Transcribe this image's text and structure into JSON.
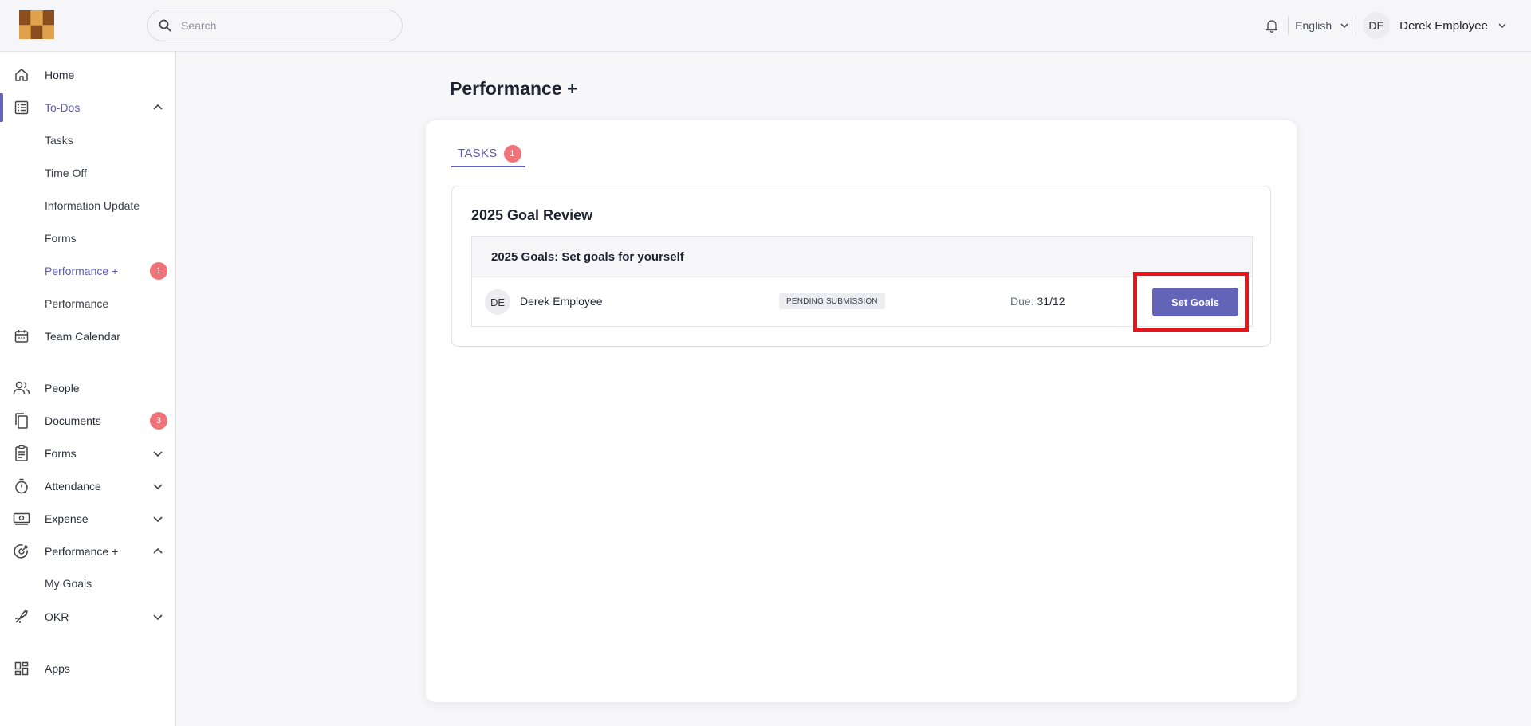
{
  "header": {
    "search_placeholder": "Search",
    "language": "English",
    "user_initials": "DE",
    "user_name": "Derek Employee"
  },
  "sidebar": {
    "items": [
      {
        "label": "Home",
        "icon": "home-icon"
      },
      {
        "label": "To-Dos",
        "icon": "checklist-icon",
        "expanded": true,
        "active": true,
        "children": [
          {
            "label": "Tasks"
          },
          {
            "label": "Time Off"
          },
          {
            "label": "Information Update"
          },
          {
            "label": "Forms"
          },
          {
            "label": "Performance +",
            "badge": "1",
            "active": true
          },
          {
            "label": "Performance"
          }
        ]
      },
      {
        "label": "Team Calendar",
        "icon": "calendar-icon"
      },
      {
        "label": "People",
        "icon": "people-icon"
      },
      {
        "label": "Documents",
        "icon": "documents-icon",
        "badge": "3"
      },
      {
        "label": "Forms",
        "icon": "clipboard-icon",
        "expandable": true
      },
      {
        "label": "Attendance",
        "icon": "stopwatch-icon",
        "expandable": true
      },
      {
        "label": "Expense",
        "icon": "banknote-icon",
        "expandable": true
      },
      {
        "label": "Performance +",
        "icon": "target-icon",
        "expanded": true,
        "children": [
          {
            "label": "My Goals"
          }
        ]
      },
      {
        "label": "OKR",
        "icon": "rocket-icon",
        "expandable": true
      },
      {
        "label": "Apps",
        "icon": "apps-grid-icon"
      }
    ]
  },
  "main": {
    "title": "Performance +",
    "tab_label": "TASKS",
    "tab_badge": "1",
    "review_title": "2025 Goal Review",
    "goal_heading": "2025 Goals: Set goals for yourself",
    "row": {
      "initials": "DE",
      "name": "Derek Employee",
      "status": "PENDING SUBMISSION",
      "due_label": "Due:",
      "due_value": "31/12",
      "action_label": "Set Goals"
    }
  },
  "colors": {
    "accent": "#6363b8",
    "badge": "#f07379",
    "highlight": "#e8141b"
  }
}
